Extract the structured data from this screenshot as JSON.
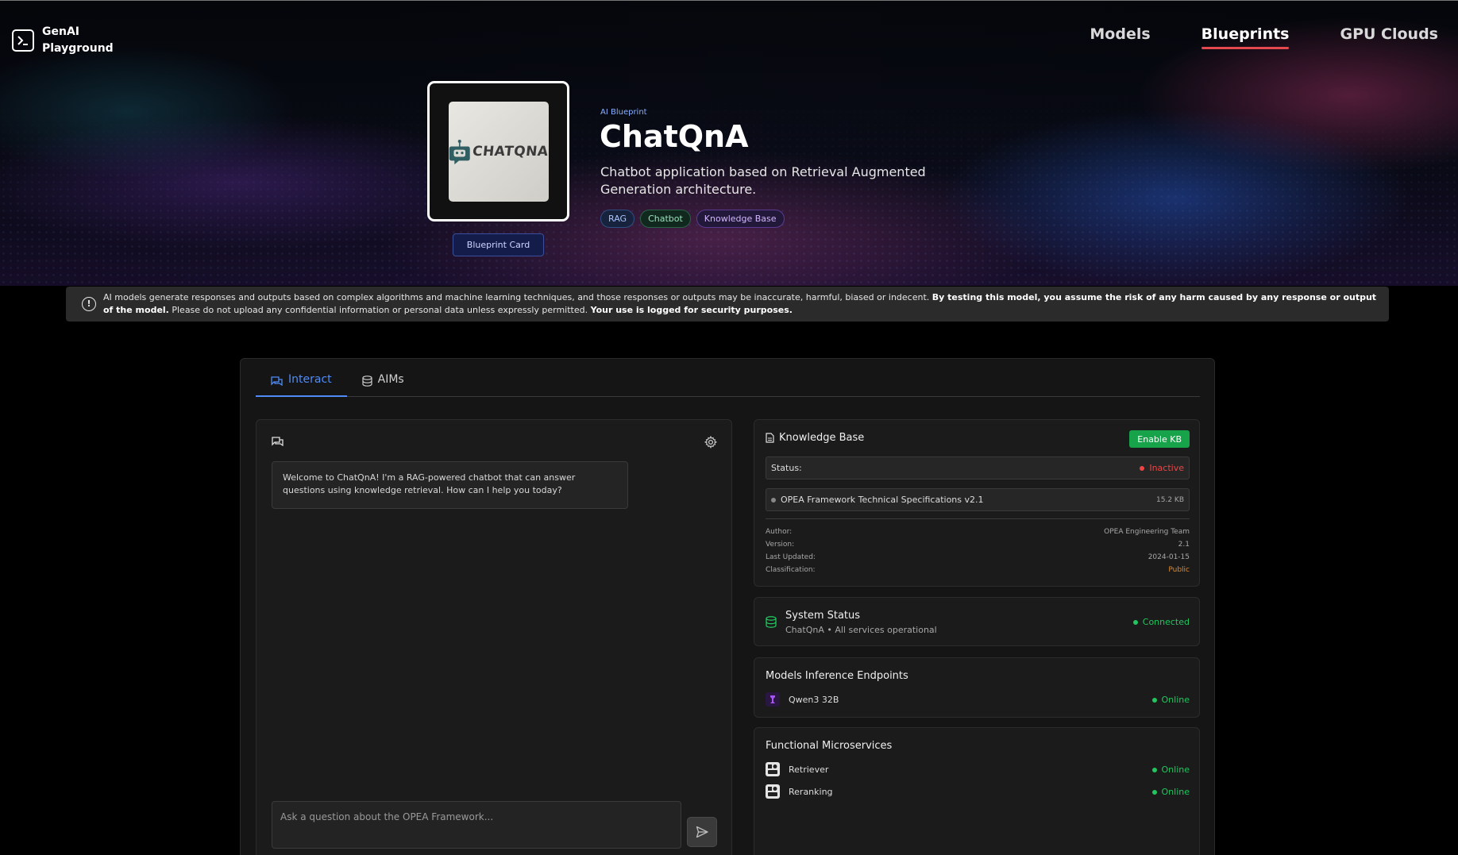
{
  "header": {
    "brand_line1": "GenAI",
    "brand_line2": "Playground",
    "nav": [
      {
        "label": "Models",
        "active": false
      },
      {
        "label": "Blueprints",
        "active": true
      },
      {
        "label": "GPU Clouds",
        "active": false
      }
    ]
  },
  "hero": {
    "card_image_text": "CHATQNA",
    "card_button": "Blueprint Card",
    "eyebrow": "AI Blueprint",
    "title": "ChatQnA",
    "subtitle": "Chatbot application based on Retrieval Augmented Generation architecture.",
    "tags": [
      "RAG",
      "Chatbot",
      "Knowledge Base"
    ]
  },
  "disclaimer": {
    "part1": "AI models generate responses and outputs based on complex algorithms and machine learning techniques, and those responses or outputs may be inaccurate, harmful, biased or indecent. ",
    "bold1": "By testing this model, you assume the risk of any harm caused by any response or output of the model.",
    "part2": " Please do not upload any confidential information or personal data unless expressly permitted. ",
    "bold2": "Your use is logged for security purposes."
  },
  "tabs": [
    {
      "label": "Interact",
      "active": true
    },
    {
      "label": "AIMs",
      "active": false
    }
  ],
  "chat": {
    "welcome": "Welcome to ChatQnA! I'm a RAG-powered chatbot that can answer questions using knowledge retrieval. How can I help you today?",
    "input_placeholder": "Ask a question about the OPEA Framework..."
  },
  "knowledge_base": {
    "title": "Knowledge Base",
    "enable_button": "Enable KB",
    "status_label": "Status:",
    "status_value": "Inactive",
    "document_name": "OPEA Framework Technical Specifications v2.1",
    "document_size": "15.2 KB",
    "meta": [
      {
        "label": "Author:",
        "value": "OPEA Engineering Team"
      },
      {
        "label": "Version:",
        "value": "2.1"
      },
      {
        "label": "Last Updated:",
        "value": "2024-01-15"
      },
      {
        "label": "Classification:",
        "value": "Public"
      }
    ]
  },
  "system_status": {
    "title": "System Status",
    "subtitle": "ChatQnA • All services operational",
    "status": "Connected"
  },
  "models": {
    "title": "Models Inference Endpoints",
    "items": [
      {
        "name": "Qwen3 32B",
        "status": "Online"
      }
    ]
  },
  "microservices": {
    "title": "Functional Microservices",
    "items": [
      {
        "name": "Retriever",
        "status": "Online"
      },
      {
        "name": "Reranking",
        "status": "Online"
      }
    ]
  },
  "colors": {
    "accent_blue": "#4f8cf6",
    "active_nav_underline": "#e5484d",
    "enable_button": "#16a34a",
    "online_green": "#22c55e",
    "inactive_red": "#ef4444",
    "classification_orange": "#e08a2e"
  },
  "icons": [
    "terminal-icon",
    "info-icon",
    "chat-bubbles-icon",
    "database-icon",
    "gear-icon",
    "send-icon",
    "document-icon",
    "robot-icon",
    "server-icon"
  ]
}
